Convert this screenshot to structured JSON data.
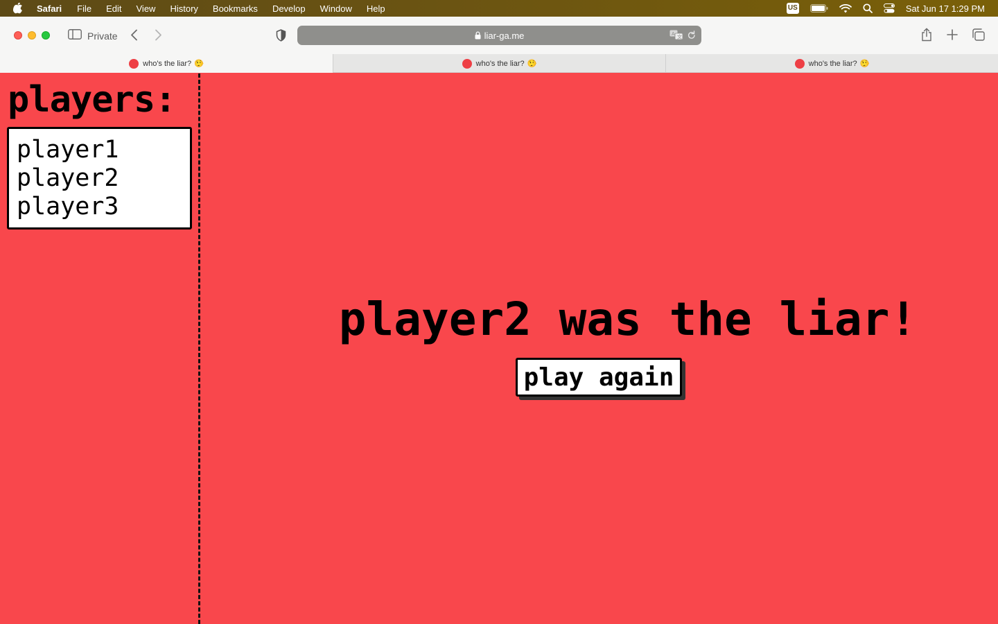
{
  "menubar": {
    "app_name": "Safari",
    "menus": [
      "File",
      "Edit",
      "View",
      "History",
      "Bookmarks",
      "Develop",
      "Window",
      "Help"
    ],
    "keyboard_layout": "US",
    "datetime": "Sat Jun 17  1:29 PM"
  },
  "toolbar": {
    "private_label": "Private",
    "url": "liar-ga.me"
  },
  "tabs": [
    {
      "title": "who's the liar?",
      "emoji": "🤥",
      "active": true
    },
    {
      "title": "who's the liar?",
      "emoji": "🤥",
      "active": false
    },
    {
      "title": "who's the liar?",
      "emoji": "🤥",
      "active": false
    }
  ],
  "game": {
    "players_heading": "players:",
    "players": [
      "player1",
      "player2",
      "player3"
    ],
    "result_text": "player2 was the liar!",
    "play_again_label": "play again"
  },
  "colors": {
    "page_background": "#f9474c",
    "favicon": "#ee3f45"
  }
}
